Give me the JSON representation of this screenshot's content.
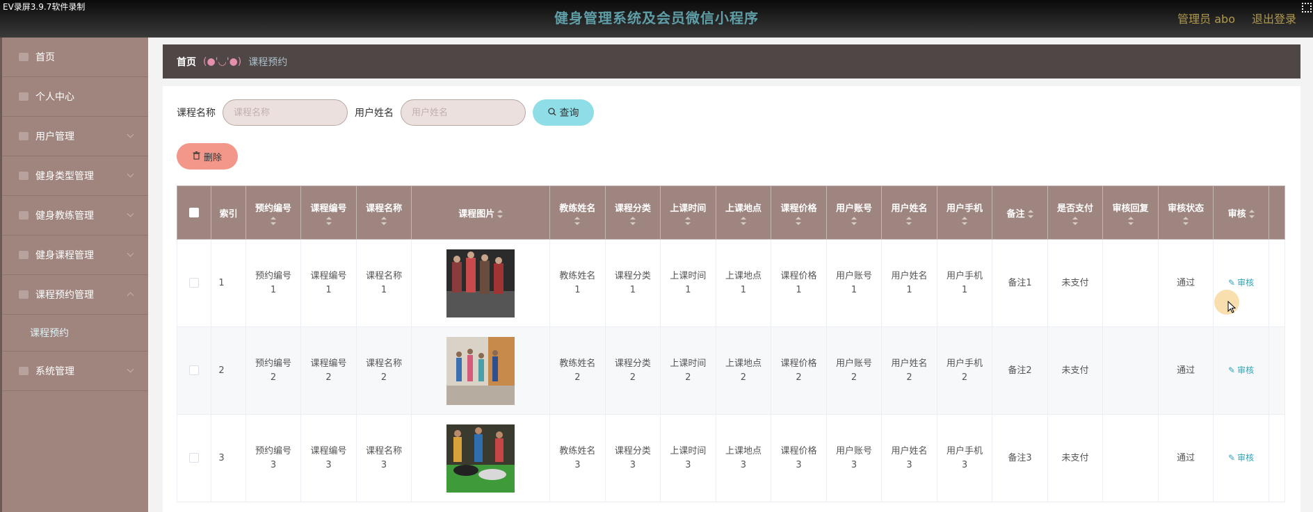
{
  "recorder_label": "EV录屏3.9.7软件录制",
  "header": {
    "title": "健身管理系统及会员微信小程序",
    "admin": "管理员 abo",
    "logout": "退出登录"
  },
  "sidebar": {
    "items": [
      {
        "label": "首页",
        "icon": "home-icon"
      },
      {
        "label": "个人中心",
        "icon": "user-icon"
      },
      {
        "label": "用户管理",
        "icon": "list-icon"
      },
      {
        "label": "健身类型管理",
        "icon": "chat-icon"
      },
      {
        "label": "健身教练管理",
        "icon": "trophy-icon"
      },
      {
        "label": "健身课程管理",
        "icon": "card-icon"
      },
      {
        "label": "课程预约管理",
        "icon": "grid-icon"
      },
      {
        "label": "系统管理",
        "icon": "send-icon"
      }
    ],
    "active_sub": "课程预约"
  },
  "breadcrumb": {
    "home": "首页",
    "separator": "(●'◡'●)",
    "current": "课程预约"
  },
  "search": {
    "course_label": "课程名称",
    "course_placeholder": "课程名称",
    "user_label": "用户姓名",
    "user_placeholder": "用户姓名",
    "query_button": "查询",
    "delete_button": "删除"
  },
  "table": {
    "headers": [
      "索引",
      "预约编号",
      "课程编号",
      "课程名称",
      "课程图片",
      "教练姓名",
      "课程分类",
      "上课时间",
      "上课地点",
      "课程价格",
      "用户账号",
      "用户姓名",
      "用户手机",
      "备注",
      "是否支付",
      "审核回复",
      "审核状态",
      "审核"
    ],
    "rows": [
      {
        "index": "1",
        "booking_no": [
          "预约编号",
          "1"
        ],
        "course_no": [
          "课程编号",
          "1"
        ],
        "course_name": [
          "课程名称",
          "1"
        ],
        "coach": [
          "教练姓名",
          "1"
        ],
        "category": [
          "课程分类",
          "1"
        ],
        "time": [
          "上课时间",
          "1"
        ],
        "place": [
          "上课地点",
          "1"
        ],
        "price": [
          "课程价格",
          "1"
        ],
        "account": [
          "用户账号",
          "1"
        ],
        "username": [
          "用户姓名",
          "1"
        ],
        "phone": [
          "用户手机",
          "1"
        ],
        "remark": "备注1",
        "paid": "未支付",
        "reply": "",
        "status": "通过",
        "action": "审核"
      },
      {
        "index": "2",
        "booking_no": [
          "预约编号",
          "2"
        ],
        "course_no": [
          "课程编号",
          "2"
        ],
        "course_name": [
          "课程名称",
          "2"
        ],
        "coach": [
          "教练姓名",
          "2"
        ],
        "category": [
          "课程分类",
          "2"
        ],
        "time": [
          "上课时间",
          "2"
        ],
        "place": [
          "上课地点",
          "2"
        ],
        "price": [
          "课程价格",
          "2"
        ],
        "account": [
          "用户账号",
          "2"
        ],
        "username": [
          "用户姓名",
          "2"
        ],
        "phone": [
          "用户手机",
          "2"
        ],
        "remark": "备注2",
        "paid": "未支付",
        "reply": "",
        "status": "通过",
        "action": "审核"
      },
      {
        "index": "3",
        "booking_no": [
          "预约编号",
          "3"
        ],
        "course_no": [
          "课程编号",
          "3"
        ],
        "course_name": [
          "课程名称",
          "3"
        ],
        "coach": [
          "教练姓名",
          "3"
        ],
        "category": [
          "课程分类",
          "3"
        ],
        "time": [
          "上课时间",
          "3"
        ],
        "place": [
          "上课地点",
          "3"
        ],
        "price": [
          "课程价格",
          "3"
        ],
        "account": [
          "用户账号",
          "3"
        ],
        "username": [
          "用户姓名",
          "3"
        ],
        "phone": [
          "用户手机",
          "3"
        ],
        "remark": "备注3",
        "paid": "未支付",
        "reply": "",
        "status": "通过",
        "action": "审核"
      }
    ]
  },
  "colors": {
    "sidebar_bg": "#a0857f",
    "header_bg": "#1a1a1a",
    "title": "#5f9ea6",
    "table_header": "#9e857f",
    "search_button": "#8fdde6",
    "delete_button": "#f2978a",
    "link": "#2aa5b8"
  }
}
